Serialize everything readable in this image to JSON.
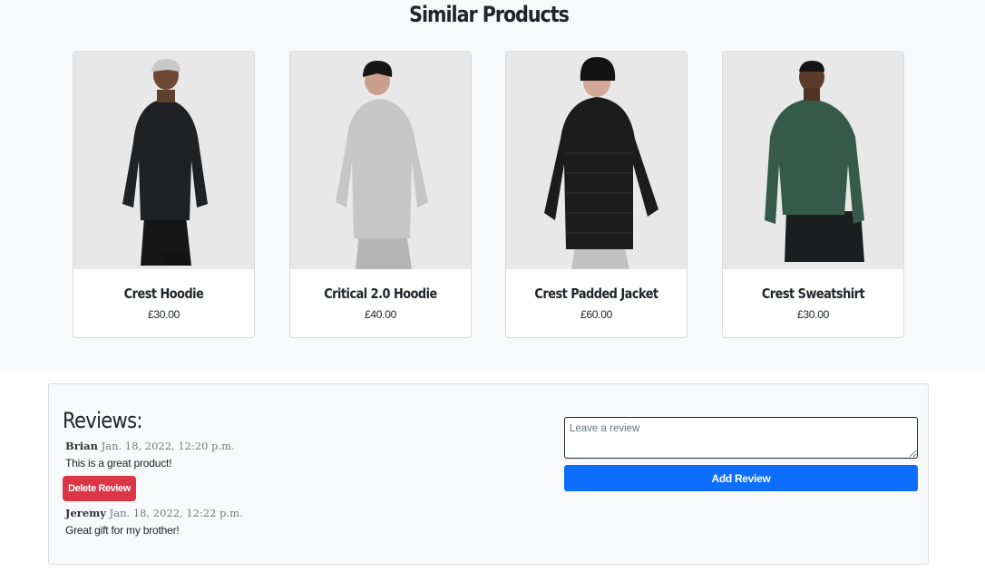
{
  "similar": {
    "title": "Similar Products",
    "products": [
      {
        "name": "Crest Hoodie",
        "price": "£30.00",
        "garment_color": "#1d1f21",
        "cap": "grey-cap"
      },
      {
        "name": "Critical 2.0 Hoodie",
        "price": "£40.00",
        "garment_color": "#c4c4c4",
        "cap": "black-cap"
      },
      {
        "name": "Crest Padded Jacket",
        "price": "£60.00",
        "garment_color": "#1b1b1b",
        "cap": "black-beanie"
      },
      {
        "name": "Crest Sweatshirt",
        "price": "£30.00",
        "garment_color": "#365a4a",
        "cap": "none"
      }
    ]
  },
  "reviews": {
    "heading": "Reviews:",
    "items": [
      {
        "author": "Brian",
        "date": "Jan. 18, 2022, 12:20 p.m.",
        "text": "This is a great product!"
      },
      {
        "author": "Jeremy",
        "date": "Jan. 18, 2022, 12:22 p.m.",
        "text": "Great gift for my brother!"
      }
    ],
    "delete_label": "Delete Review",
    "input_placeholder": "Leave a review",
    "add_label": "Add Review"
  },
  "colors": {
    "section_bg": "#f8f9fa",
    "danger": "#dc3545",
    "primary": "#0d6efd"
  }
}
